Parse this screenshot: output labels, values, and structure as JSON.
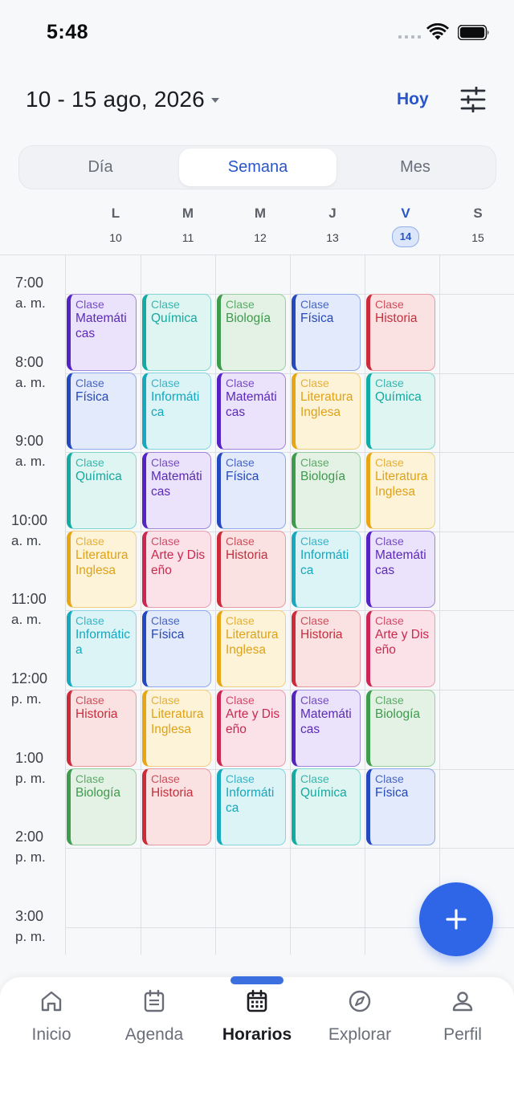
{
  "status_bar": {
    "time": "5:48"
  },
  "header": {
    "range_title": "10 - 15 ago, 2026",
    "today_label": "Hoy"
  },
  "view_tabs": [
    {
      "label": "Día",
      "active": false
    },
    {
      "label": "Semana",
      "active": true
    },
    {
      "label": "Mes",
      "active": false
    }
  ],
  "days": [
    {
      "dow": "L",
      "num": "10",
      "today": false
    },
    {
      "dow": "M",
      "num": "11",
      "today": false
    },
    {
      "dow": "M",
      "num": "12",
      "today": false
    },
    {
      "dow": "J",
      "num": "13",
      "today": false
    },
    {
      "dow": "V",
      "num": "14",
      "today": true
    },
    {
      "dow": "S",
      "num": "15",
      "today": false
    }
  ],
  "time_slots": [
    {
      "time": "7:00",
      "period": "a. m."
    },
    {
      "time": "8:00",
      "period": "a. m."
    },
    {
      "time": "9:00",
      "period": "a. m."
    },
    {
      "time": "10:00",
      "period": "a. m."
    },
    {
      "time": "11:00",
      "period": "a. m."
    },
    {
      "time": "12:00",
      "period": "p. m."
    },
    {
      "time": "1:00",
      "period": "p. m."
    },
    {
      "time": "2:00",
      "period": "p. m."
    },
    {
      "time": "3:00",
      "period": "p. m."
    }
  ],
  "event_kind": "Clase",
  "subject_colors": {
    "Matemáticas": {
      "text": "#5b2ab8",
      "bg": "#ebe3fb",
      "border": "#9f84de",
      "bar": "#5522c4"
    },
    "Química": {
      "text": "#13a9a0",
      "bg": "#dff5f2",
      "border": "#7fd7cf",
      "bar": "#14aba2"
    },
    "Biología": {
      "text": "#3d9a4b",
      "bg": "#e4f2e6",
      "border": "#98cfa0",
      "bar": "#3f9c4d"
    },
    "Física": {
      "text": "#2448b8",
      "bg": "#e3eafb",
      "border": "#8ea8ea",
      "bar": "#2448c0"
    },
    "Historia": {
      "text": "#c52f3d",
      "bg": "#fae1e2",
      "border": "#e99aa1",
      "bar": "#cc2b3a"
    },
    "Informática": {
      "text": "#14a7bd",
      "bg": "#ddf4f7",
      "border": "#84d5e0",
      "bar": "#18a9bf"
    },
    "Literatura Inglesa": {
      "text": "#dfa218",
      "bg": "#fdf3d8",
      "border": "#f0cf7e",
      "bar": "#e6a616"
    },
    "Arte y Diseño": {
      "text": "#c8294f",
      "bg": "#fbe2e8",
      "border": "#ea9db0",
      "bar": "#cc2753"
    }
  },
  "schedule": [
    [
      "Matemáticas",
      "Química",
      "Biología",
      "Física",
      "Historia"
    ],
    [
      "Física",
      "Informática",
      "Matemáticas",
      "Literatura Inglesa",
      "Química"
    ],
    [
      "Química",
      "Matemáticas",
      "Física",
      "Biología",
      "Literatura Inglesa"
    ],
    [
      "Literatura Inglesa",
      "Arte y Diseño",
      "Historia",
      "Informática",
      "Matemáticas"
    ],
    [
      "Informática",
      "Física",
      "Literatura Inglesa",
      "Historia",
      "Arte y Diseño"
    ],
    [
      "Historia",
      "Literatura Inglesa",
      "Arte y Diseño",
      "Matemáticas",
      "Biología"
    ],
    [
      "Biología",
      "Historia",
      "Informática",
      "Química",
      "Física"
    ]
  ],
  "fab": {
    "icon": "plus-icon"
  },
  "bottom_nav": [
    {
      "label": "Inicio",
      "icon": "home-icon",
      "active": false
    },
    {
      "label": "Agenda",
      "icon": "agenda-icon",
      "active": false
    },
    {
      "label": "Horarios",
      "icon": "calendar-icon",
      "active": true
    },
    {
      "label": "Explorar",
      "icon": "compass-icon",
      "active": false
    },
    {
      "label": "Perfil",
      "icon": "person-icon",
      "active": false
    }
  ]
}
